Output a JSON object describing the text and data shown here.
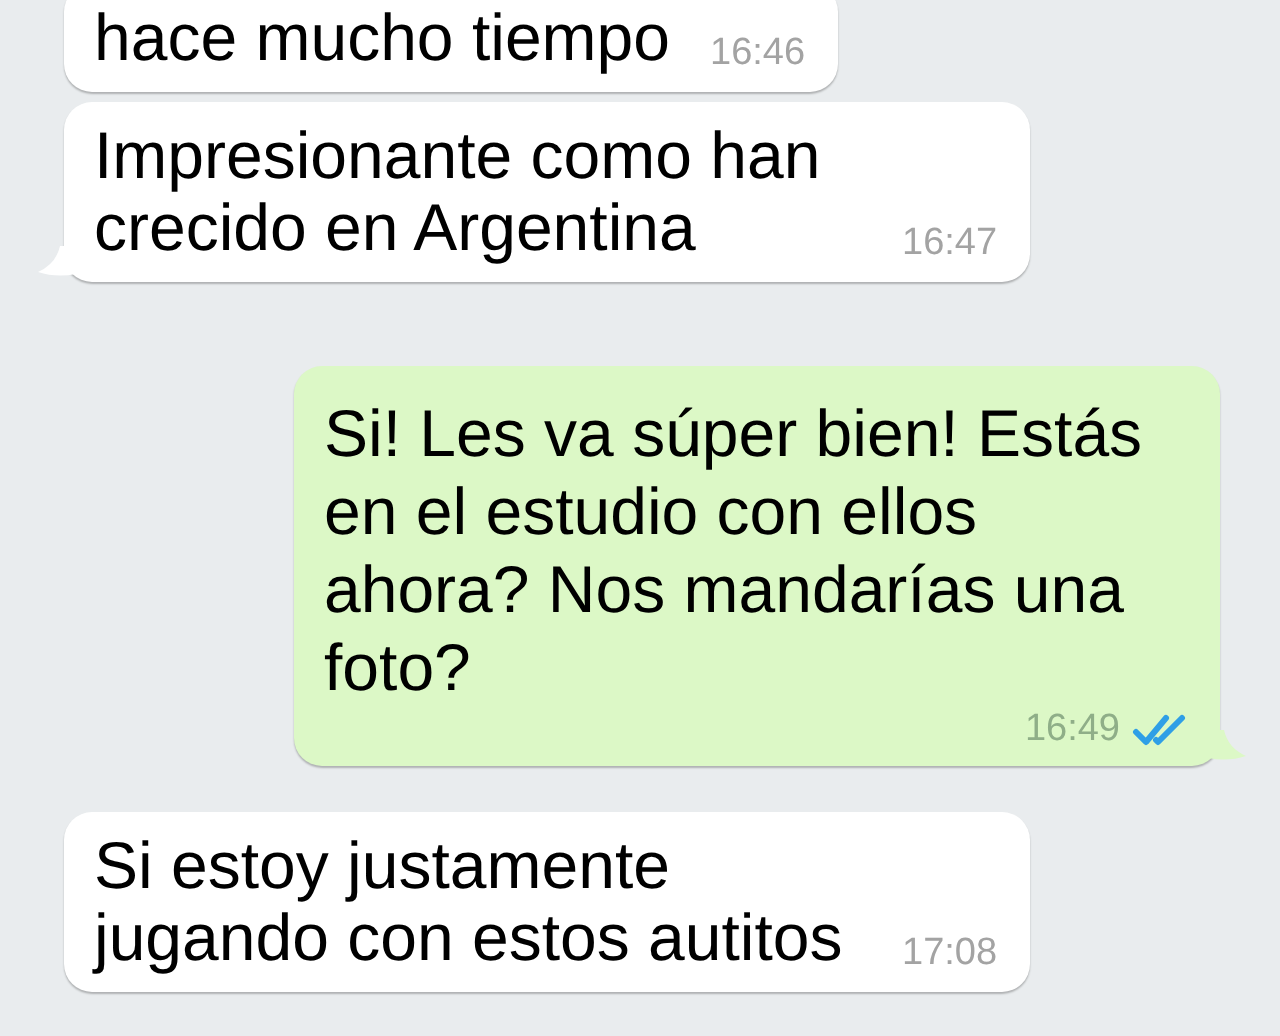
{
  "messages": [
    {
      "outgoing": false,
      "text": "hace mucho tiempo",
      "time": "16:46",
      "tail": false
    },
    {
      "outgoing": false,
      "text": "Impresionante como han crecido en Argentina",
      "time": "16:47",
      "tail": true
    },
    {
      "outgoing": true,
      "text": "Si! Les va súper bien! Estás en el estudio con ellos ahora? Nos mandarías una foto?",
      "time": "16:49",
      "tail": true,
      "read": true
    },
    {
      "outgoing": false,
      "text": "Si estoy justamente jugando con estos autitos",
      "time": "17:08",
      "tail": false
    }
  ]
}
